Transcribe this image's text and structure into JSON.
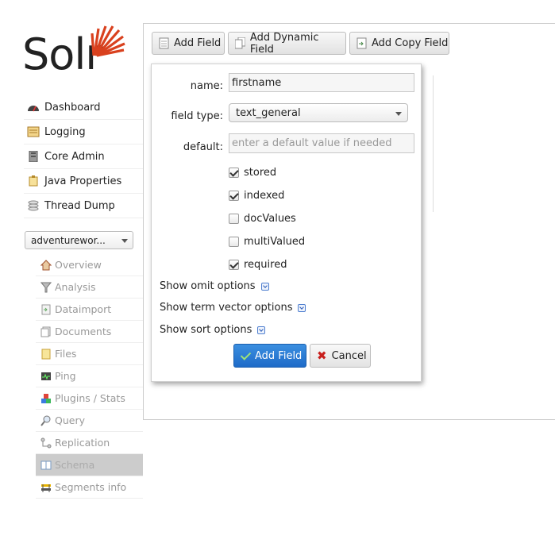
{
  "brand": {
    "logo_text": "Solr",
    "accent": "#d9411e"
  },
  "nav": {
    "items": [
      {
        "label": "Dashboard",
        "icon": "dashboard-icon"
      },
      {
        "label": "Logging",
        "icon": "logging-icon"
      },
      {
        "label": "Core Admin",
        "icon": "core-admin-icon"
      },
      {
        "label": "Java Properties",
        "icon": "java-properties-icon"
      },
      {
        "label": "Thread Dump",
        "icon": "thread-dump-icon"
      }
    ]
  },
  "core_selector": {
    "value": "adventurewor..."
  },
  "core_menu": {
    "items": [
      {
        "label": "Overview",
        "icon": "home-icon"
      },
      {
        "label": "Analysis",
        "icon": "funnel-icon"
      },
      {
        "label": "Dataimport",
        "icon": "dataimport-icon"
      },
      {
        "label": "Documents",
        "icon": "documents-icon"
      },
      {
        "label": "Files",
        "icon": "files-icon"
      },
      {
        "label": "Ping",
        "icon": "ping-icon"
      },
      {
        "label": "Plugins / Stats",
        "icon": "plugins-icon"
      },
      {
        "label": "Query",
        "icon": "query-icon"
      },
      {
        "label": "Replication",
        "icon": "replication-icon"
      },
      {
        "label": "Schema",
        "icon": "schema-icon",
        "active": true
      },
      {
        "label": "Segments info",
        "icon": "segments-icon"
      }
    ]
  },
  "toolbar": {
    "add_field": "Add Field",
    "add_dynamic_field": "Add Dynamic Field",
    "add_copy_field": "Add Copy Field"
  },
  "popup": {
    "name_label": "name:",
    "name_value": "firstname",
    "field_type_label": "field type:",
    "field_type_value": "text_general",
    "default_label": "default:",
    "default_placeholder": "enter a default value if needed",
    "checkboxes": [
      {
        "label": "stored",
        "checked": true
      },
      {
        "label": "indexed",
        "checked": true
      },
      {
        "label": "docValues",
        "checked": false
      },
      {
        "label": "multiValued",
        "checked": false
      },
      {
        "label": "required",
        "checked": true
      }
    ],
    "options": {
      "omit": "Show omit options",
      "term_vector": "Show term vector options",
      "sort": "Show sort options"
    },
    "submit_label": "Add Field",
    "cancel_label": "Cancel"
  }
}
